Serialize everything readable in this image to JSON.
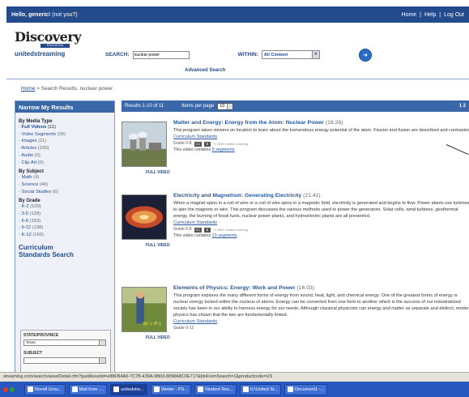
{
  "topbar": {
    "greeting": "Hello, generic!",
    "not_you": "(not you?)",
    "home": "Home",
    "help": "Help",
    "logout": "Log Out",
    "sep": "|"
  },
  "logo": {
    "brand": "Discovery",
    "edu": "EDUCATION",
    "sub": "unitedstreaming"
  },
  "search": {
    "label": "SEARCH:",
    "value": "nuclear power",
    "within_label": "WITHIN:",
    "within_value": "All Content",
    "advanced": "Advanced Search"
  },
  "breadcrumb": {
    "home": "Home",
    "current": " > Search Results: nuclear power"
  },
  "sidebar": {
    "title": "Narrow My Results",
    "groups": [
      {
        "label": "By Media Type",
        "items": [
          {
            "label": "Full Videos",
            "count": "(11)",
            "bold": true
          },
          {
            "label": "Video Segments",
            "count": "(39)"
          },
          {
            "label": "Images",
            "count": "(11)"
          },
          {
            "label": "Articles",
            "count": "(100)"
          },
          {
            "label": "Audio",
            "count": "(0)"
          },
          {
            "label": "Clip Art",
            "count": "(0)"
          }
        ]
      },
      {
        "label": "By Subject",
        "items": [
          {
            "label": "Math",
            "count": "(4)"
          },
          {
            "label": "Science",
            "count": "(46)"
          },
          {
            "label": "Social Studies",
            "count": "(6)"
          }
        ]
      },
      {
        "label": "By Grade",
        "items": [
          {
            "label": "K-2",
            "count": "(109)"
          },
          {
            "label": "3-5",
            "count": "(128)"
          },
          {
            "label": "6-8",
            "count": "(153)"
          },
          {
            "label": "9-12",
            "count": "(138)"
          },
          {
            "label": "K-12",
            "count": "(160)"
          }
        ]
      }
    ],
    "curriculum_title_1": "Curriculum",
    "curriculum_title_2": "Standards Search",
    "state_label": "STATE/PROVINCE",
    "state_value": "Texas",
    "subject_label": "SUBJECT"
  },
  "results_bar": {
    "range": "Results 1-10 of 11",
    "per_page_label": "Items per page",
    "per_page_value": "10",
    "pager": "1 2"
  },
  "results": [
    {
      "title": "Matter and Energy: Energy from the Atom: Nuclear Power",
      "duration": "(18:26)",
      "desc": "This program takes viewers on location to learn about the tremendous energy potential of the atom. Fission and fusion are described and contrasted.",
      "curriculum": "Curriculum Standards",
      "grades": "Grade 6-8",
      "copyright": "© 2005 United Learning",
      "contains": "This video contains ",
      "segments": "5 segments",
      "full_video": "FULL VIDEO"
    },
    {
      "title": "Electricity and Magnetism: Generating Electricity",
      "duration": "(21:41)",
      "desc": "When a magnet spins in a coil of wire or a coil of wire spins in a magnetic field, electricity is generated and begins to flow. Power plants use turbines to spin the magnets or wire. This program discusses the various methods used to power the generators. Solar cells, wind turbines, geothermal energy, the burning of fossil fuels, nuclear power plants, and hydroelectric plants are all presented.",
      "curriculum": "Curriculum Standards",
      "grades": "Grade 6-8",
      "copyright": "© 2004 United Learning",
      "contains": "This video contains ",
      "segments": "13 segments",
      "full_video": "FULL VIDEO"
    },
    {
      "title": "Elements of Physics: Energy: Work and Power",
      "duration": "(16:03)",
      "desc": "This program explores the many different forms of energy from sound, heat, light, and chemical energy. One of the greatest forms of energy is nuclear energy locked within the nucleus of atoms. Energy can be converted from one form to another which is the success of our industrialized society has been in our ability to harness energy for our needs. Although classical physicists can energy and matter as separate and distinct, modern physics has shown that the two are fundamentally linked.",
      "curriculum": "Curriculum Standards",
      "grades": "Grade 9-12",
      "copyright": "",
      "contains": "",
      "segments": "",
      "full_video": "FULL VIDEO"
    }
  ],
  "status_bar": "streaming.com/search/assetDetail.cfm?guidAssetId=e88FB4A0-7C7B-439A-9B03-8098A8C0E717&blnFromSearch=1&productcode=US",
  "taskbar": {
    "items": [
      "Novell Grou...",
      "Mail from -...",
      "unitedstre...",
      "Wetter - PS...",
      "Student Res...",
      "H:\\United St...",
      "Document1 -..."
    ],
    "active_index": 2
  },
  "colors": {
    "brand_blue": "#234b8c",
    "bar_blue": "#3a67a8",
    "link_blue": "#2a57a0"
  }
}
